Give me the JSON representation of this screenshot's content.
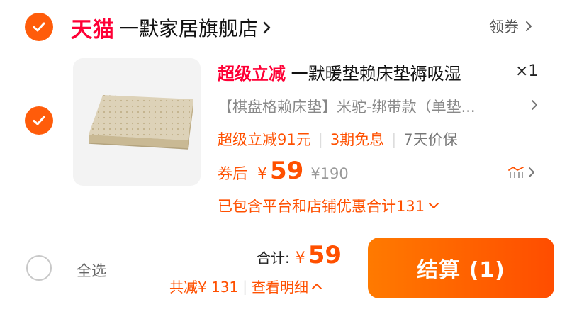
{
  "store": {
    "brand": "天猫",
    "name": "一默家居旗舰店",
    "coupon_label": "领券"
  },
  "item": {
    "promo_tag": "超级立减",
    "title": "一默暖垫赖床垫褥吸湿",
    "quantity": "×1",
    "sku": "【棋盘格赖床垫】米驼-绑带款（单垫...",
    "benefits": [
      "超级立减91元",
      "3期免息",
      "7天价保"
    ],
    "price_prefix": "券后",
    "currency": "¥",
    "price": "59",
    "original_price": "¥190",
    "discount_note": "已包含平台和店铺优惠合计131"
  },
  "footer": {
    "select_all": "全选",
    "total_label": "合计:",
    "total_currency": "¥",
    "total_value": "59",
    "saved": "共减¥ 131",
    "details": "查看明细",
    "checkout": "结算 (1)"
  },
  "colors": {
    "accent": "#ff5c0a",
    "brand_red": "#ff0036",
    "price_orange": "#ff5000"
  },
  "icons": {
    "check": "check-icon",
    "chevron": "chevron-right-icon",
    "price_trend": "price-trend-icon"
  }
}
